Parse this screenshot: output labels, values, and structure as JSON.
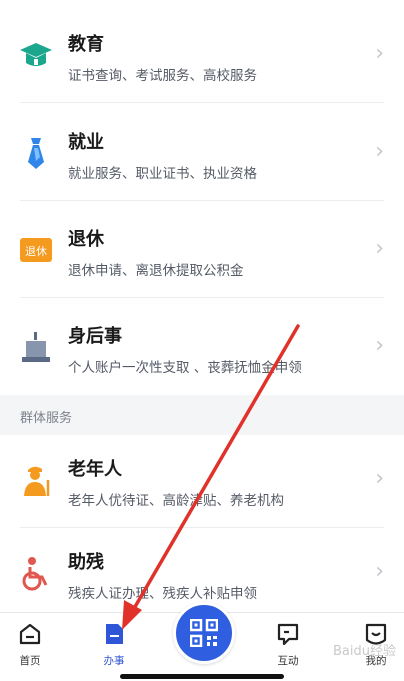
{
  "services": [
    {
      "title": "教育",
      "subtitle": "证书查询、考试服务、高校服务",
      "icon": "graduation-cap-icon",
      "color": "#1aa78e"
    },
    {
      "title": "就业",
      "subtitle": "就业服务、职业证书、执业资格",
      "icon": "tie-icon",
      "color": "#2f86e8"
    },
    {
      "title": "退休",
      "subtitle": "退休申请、离退休提取公积金",
      "icon": "retire-badge-icon",
      "color": "#f39a1f",
      "badge_text": "退休"
    },
    {
      "title": "身后事",
      "subtitle": "个人账户一次性支取 、丧葬抚恤金申领",
      "icon": "memorial-candle-icon",
      "color": "#5a6a86"
    }
  ],
  "group_section": {
    "title": "群体服务",
    "items": [
      {
        "title": "老年人",
        "subtitle": "老年人优待证、高龄津贴、养老机构",
        "icon": "elderly-person-icon",
        "color": "#f39a1f"
      },
      {
        "title": "助残",
        "subtitle": "残疾人证办理、残疾人补贴申领",
        "icon": "wheelchair-icon",
        "color": "#e0574f"
      }
    ]
  },
  "tabbar": {
    "items": [
      {
        "label": "首页",
        "icon": "home-icon"
      },
      {
        "label": "办事",
        "icon": "document-icon",
        "active": true
      },
      {
        "label": "互动",
        "icon": "chat-icon"
      },
      {
        "label": "我的",
        "icon": "profile-icon"
      }
    ],
    "center_icon": "qr-code-icon",
    "accent": "#2f5fe0"
  },
  "watermark": "Baidu经验",
  "annotation_arrow_color": "#e0322a"
}
